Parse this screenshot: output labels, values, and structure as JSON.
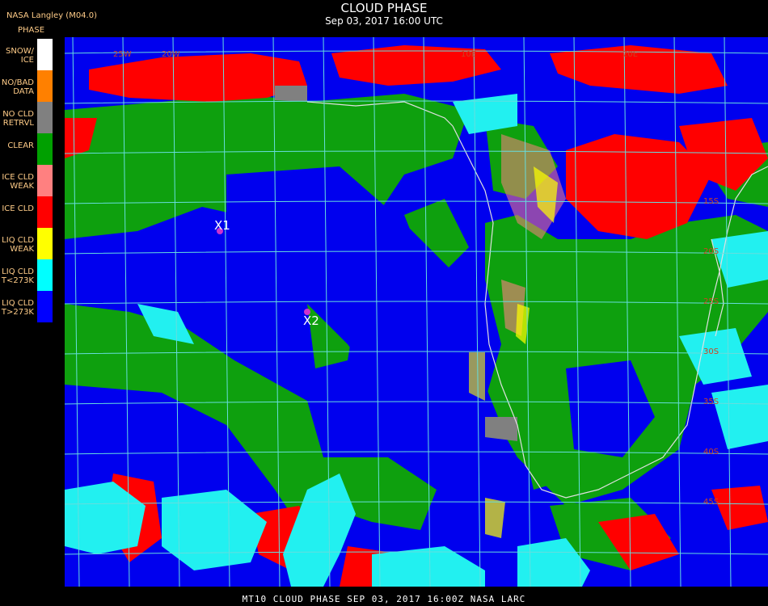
{
  "header": {
    "agency": "NASA Langley (M04.0)",
    "legend_title": "PHASE",
    "title": "CLOUD PHASE",
    "subtitle": "Sep 03, 2017 16:00 UTC"
  },
  "legend": [
    {
      "label": "SNOW/\nICE",
      "color": "#ffffff"
    },
    {
      "label": "NO/BAD\nDATA",
      "color": "#ff8000"
    },
    {
      "label": "NO CLD\nRETRVL",
      "color": "#808080"
    },
    {
      "label": "CLEAR",
      "color": "#00a000"
    },
    {
      "label": "ICE CLD\nWEAK",
      "color": "#ff8080"
    },
    {
      "label": "ICE CLD",
      "color": "#ff0000"
    },
    {
      "label": "LIQ CLD\nWEAK",
      "color": "#ffff00"
    },
    {
      "label": "LIQ CLD\nT<273K",
      "color": "#00ffff"
    },
    {
      "label": "LIQ CLD\nT>273K",
      "color": "#0000ff"
    }
  ],
  "markers": [
    {
      "label": "X1"
    },
    {
      "label": "X2"
    }
  ],
  "map": {
    "grid_color": "#66dddd",
    "marker_color": "#cc33cc",
    "coast_color": "#e0e0e0"
  },
  "footer": "MT10  CLOUD PHASE   SEP 03, 2017 16:00Z   NASA LARC"
}
